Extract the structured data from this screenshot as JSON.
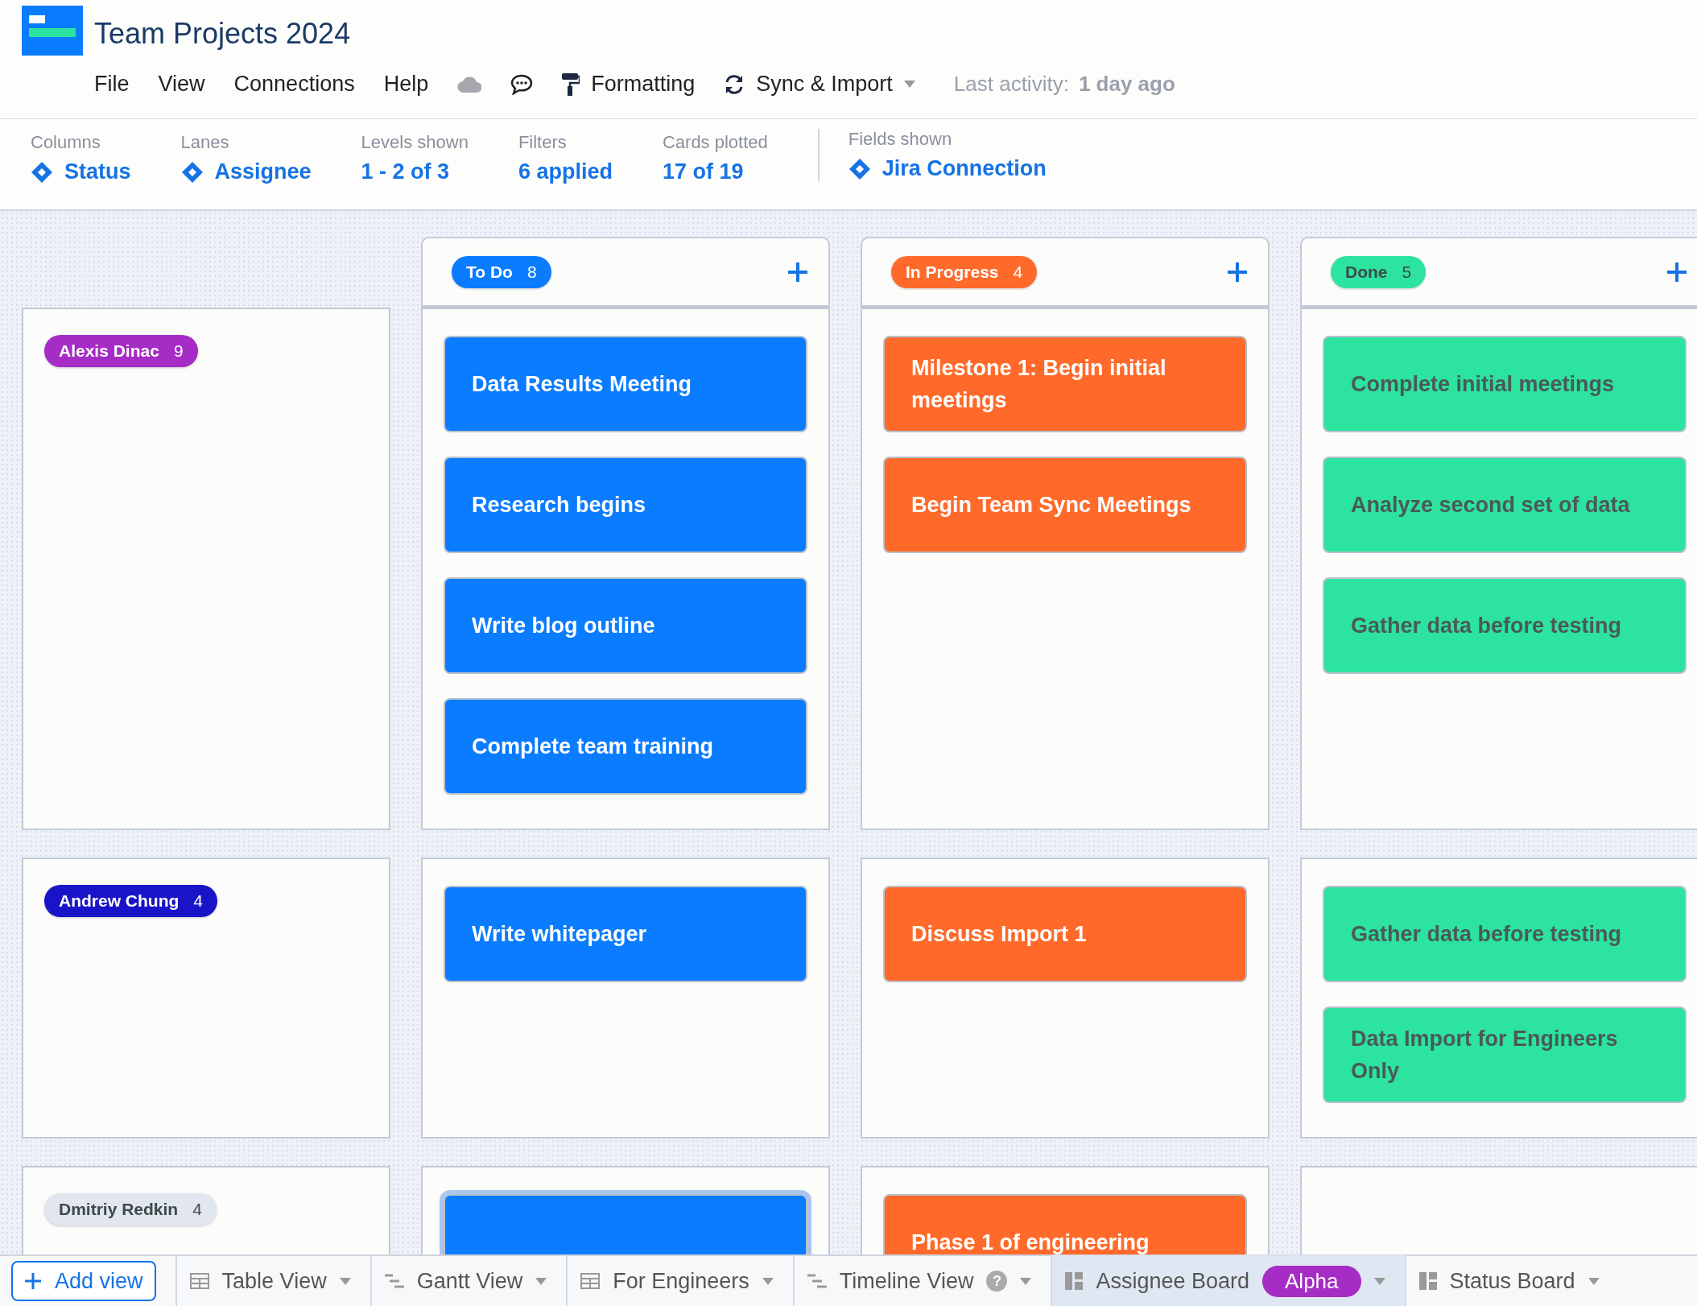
{
  "app": {
    "title": "Team Projects 2024"
  },
  "menu": [
    "File",
    "View",
    "Connections",
    "Help"
  ],
  "toolbar": {
    "formatting": "Formatting",
    "sync": "Sync & Import",
    "activity_label": "Last activity:",
    "activity_value": "1 day ago"
  },
  "settings": [
    {
      "label": "Columns",
      "value": "Status",
      "kind": "field"
    },
    {
      "label": "Lanes",
      "value": "Assignee",
      "kind": "field"
    },
    {
      "label": "Levels shown",
      "value": "1 - 2 of 3",
      "kind": "plain"
    },
    {
      "label": "Filters",
      "value": "6 applied",
      "kind": "plain"
    },
    {
      "label": "Cards plotted",
      "value": "17 of 19",
      "kind": "plain"
    },
    {
      "label": "Fields shown",
      "value": "Jira Connection",
      "kind": "divided"
    }
  ],
  "columns": [
    {
      "label": "To Do",
      "count": "8",
      "color": "#0a7cff"
    },
    {
      "label": "In Progress",
      "count": "4",
      "color": "#ff6a2a"
    },
    {
      "label": "Done",
      "count": "5",
      "color": "#2de3a0"
    }
  ],
  "lanes": [
    {
      "name": "Alexis Dinac",
      "count": "9",
      "color": "#a52cc4",
      "cells": [
        [
          {
            "title": "Data Results Meeting",
            "selected": false
          },
          {
            "title": "Research begins",
            "selected": false
          },
          {
            "title": "Write blog outline",
            "selected": false
          },
          {
            "title": "Complete team training",
            "selected": false
          }
        ],
        [
          {
            "title": "Milestone 1: Begin initial meetings",
            "selected": false
          },
          {
            "title": "Begin Team Sync Meetings",
            "selected": false
          }
        ],
        [
          {
            "title": "Complete initial meetings",
            "selected": false
          },
          {
            "title": "Analyze second set of data",
            "selected": false
          },
          {
            "title": "Gather data before testing",
            "selected": false
          }
        ]
      ]
    },
    {
      "name": "Andrew Chung",
      "count": "4",
      "color": "#1a14c8",
      "cells": [
        [
          {
            "title": "Write whitepager",
            "selected": false
          }
        ],
        [
          {
            "title": "Discuss Import 1",
            "selected": false
          }
        ],
        [
          {
            "title": "Gather data before testing",
            "selected": false
          },
          {
            "title": "Data Import for Engineers Only",
            "selected": false
          }
        ]
      ]
    },
    {
      "name": "Dmitriy Redkin",
      "count": "4",
      "color": "#e1e6ef",
      "cells": [
        [
          {
            "selected": true
          }
        ],
        [
          {
            "title": "Phase 1 of engineering",
            "selected": false
          }
        ],
        []
      ]
    }
  ],
  "views": {
    "add": "Add view",
    "tabs": [
      {
        "label": "Table View",
        "kind": "table",
        "selected": false
      },
      {
        "label": "Gantt View",
        "kind": "gantt",
        "selected": false
      },
      {
        "label": "For Engineers",
        "kind": "table",
        "selected": false
      },
      {
        "label": "Timeline View",
        "kind": "gantt",
        "help": "?",
        "selected": false
      },
      {
        "label": "Assignee Board",
        "kind": "board",
        "badge": "Alpha",
        "selected": true
      },
      {
        "label": "Status Board",
        "kind": "board",
        "selected": false
      }
    ]
  }
}
